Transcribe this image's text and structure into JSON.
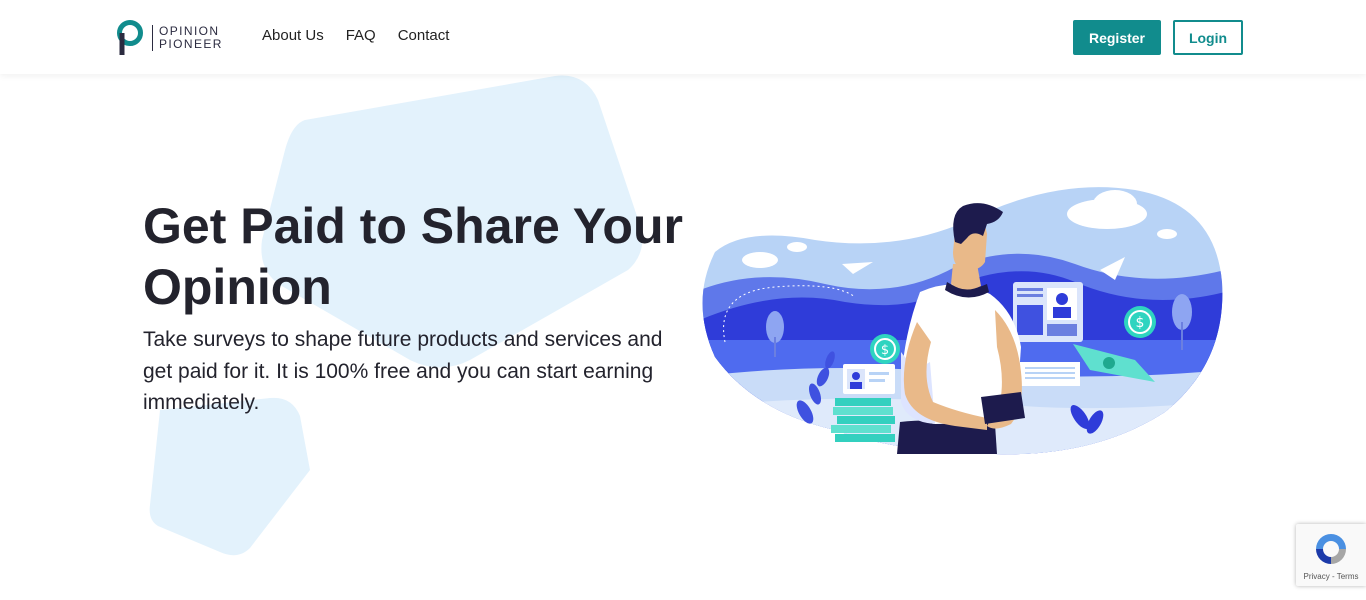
{
  "brand": {
    "name_line1": "OPINION",
    "name_line2": "PIONEER",
    "color": "#118c8d",
    "dark": "#2b2b40"
  },
  "nav": {
    "items": [
      {
        "label": "About Us"
      },
      {
        "label": "FAQ"
      },
      {
        "label": "Contact"
      }
    ]
  },
  "header": {
    "register_label": "Register",
    "login_label": "Login"
  },
  "hero": {
    "title": "Get Paid to Share Your Opinion",
    "subtitle": "Take surveys to shape future products and services and get paid for it. It is 100% free and you can start earning immediately."
  },
  "recaptcha": {
    "links": "Privacy - Terms"
  },
  "colors": {
    "accent": "#118c8d",
    "shape_light": "#e3f2fc",
    "illustration_blue": "#2f3cd9",
    "illustration_light": "#b8d3f6"
  }
}
